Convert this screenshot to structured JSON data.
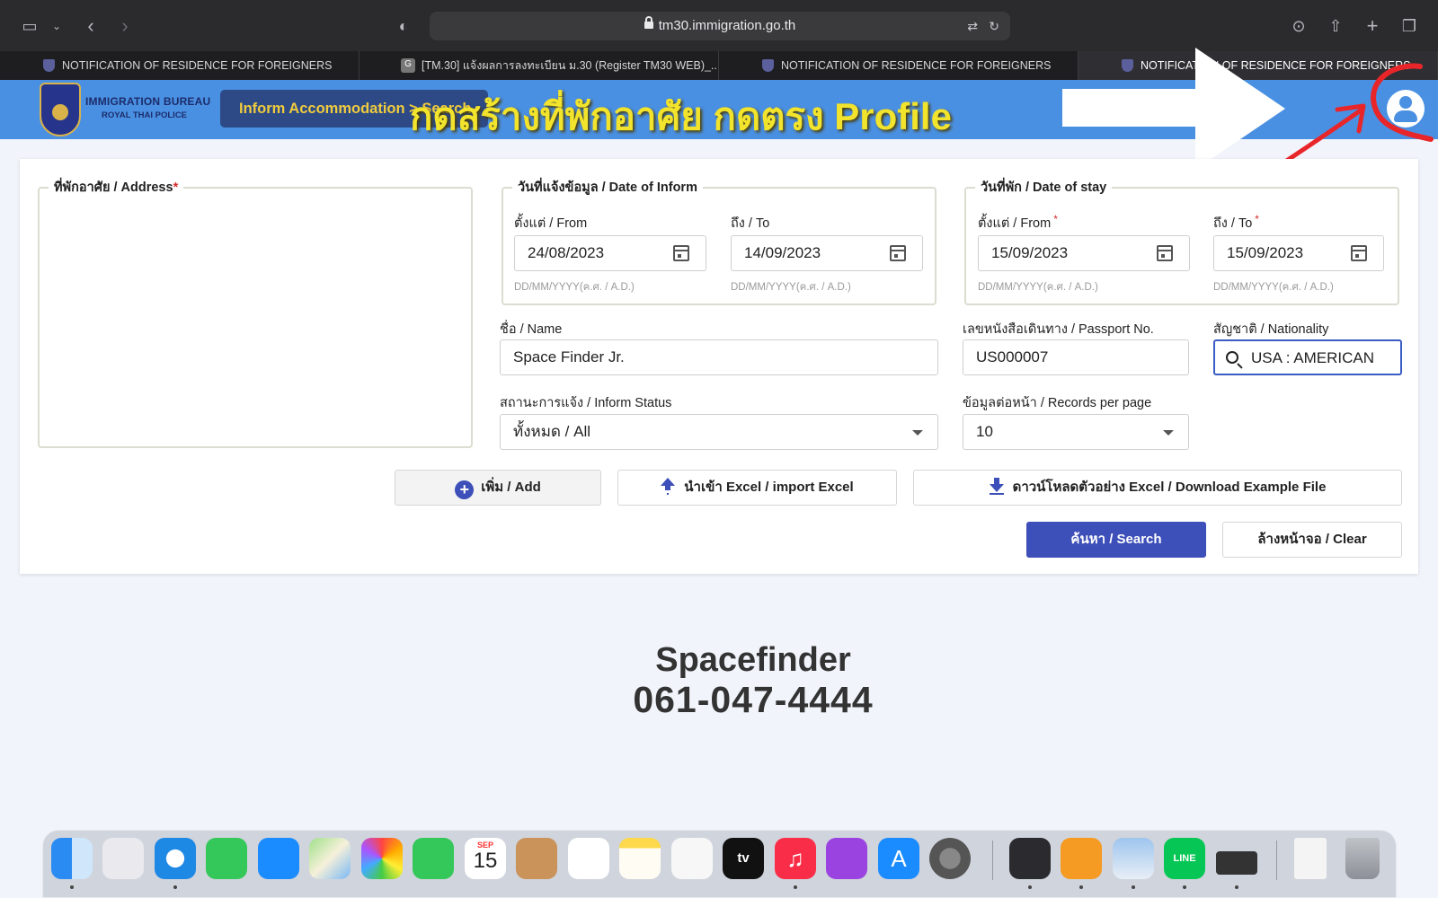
{
  "browser": {
    "url": "tm30.immigration.go.th",
    "tabs": [
      {
        "label": "NOTIFICATION OF RESIDENCE FOR FOREIGNERS",
        "active": false
      },
      {
        "label": "[TM.30] แจ้งผลการลงทะเบียน ม.30 (Register TM30 WEB)_...",
        "active": false,
        "favicon": "G"
      },
      {
        "label": "NOTIFICATION OF RESIDENCE FOR FOREIGNERS",
        "active": false
      },
      {
        "label": "NOTIFICATION OF RESIDENCE FOR FOREIGNERS",
        "active": true
      }
    ]
  },
  "header": {
    "brand_line1": "IMMIGRATION BUREAU",
    "brand_line2": "ROYAL THAI POLICE",
    "breadcrumb": "Inform Accommodation > Search",
    "overlay_instruction": "กดสร้างที่พักอาศัย กดตรง Profile",
    "profile_icon": "user-circle-icon"
  },
  "form": {
    "address_legend": "ที่พักอาศัย / Address",
    "inform_legend": "วันที่แจ้งข้อมูล / Date of Inform",
    "stay_legend": "วันที่พัก / Date of stay",
    "from_label": "ตั้งแต่ / From",
    "to_label": "ถึง / To",
    "date_hint": "DD/MM/YYYY(ค.ศ. / A.D.)",
    "inform_from": "24/08/2023",
    "inform_to": "14/09/2023",
    "stay_from": "15/09/2023",
    "stay_to": "15/09/2023",
    "name_label": "ชื่อ / Name",
    "name_value": "Space Finder Jr.",
    "passport_label": "เลขหนังสือเดินทาง / Passport No.",
    "passport_value": "US000007",
    "nationality_label": "สัญชาติ / Nationality",
    "nationality_value": "USA : AMERICAN",
    "status_label": "สถานะการแจ้ง / Inform Status",
    "status_value": "ทั้งหมด / All",
    "records_label": "ข้อมูลต่อหน้า / Records per page",
    "records_value": "10",
    "required_mark": "*"
  },
  "buttons": {
    "add": "เพิ่ม / Add",
    "import": "นำเข้า Excel / import Excel",
    "download": "ดาวน์โหลดตัวอย่าง Excel / Download Example File",
    "search": "ค้นหา / Search",
    "clear": "ล้างหน้าจอ / Clear"
  },
  "watermark": {
    "name": "Spacefinder",
    "phone": "061-047-4444"
  },
  "dock": {
    "calendar_month": "SEP",
    "calendar_day": "15",
    "tv_label": "tv",
    "line_label": "LINE",
    "apps": [
      "finder-icon",
      "launchpad-icon",
      "safari-icon",
      "messages-icon",
      "mail-icon",
      "maps-icon",
      "photos-icon",
      "facetime-icon",
      "calendar-icon",
      "contacts-icon",
      "reminders-icon",
      "notes-icon",
      "freeform-icon",
      "apple-tv-icon",
      "music-icon",
      "podcasts-icon",
      "app-store-icon",
      "system-settings-icon",
      "screen-recorder-icon",
      "pages-icon",
      "preview-icon",
      "line-icon",
      "printer-icon",
      "document-icon",
      "trash-icon"
    ]
  },
  "colors": {
    "header_blue": "#4a90e2",
    "primary_button": "#3d4fb8",
    "overlay_yellow": "#f2e32c",
    "annotation_red": "#e8262a"
  }
}
